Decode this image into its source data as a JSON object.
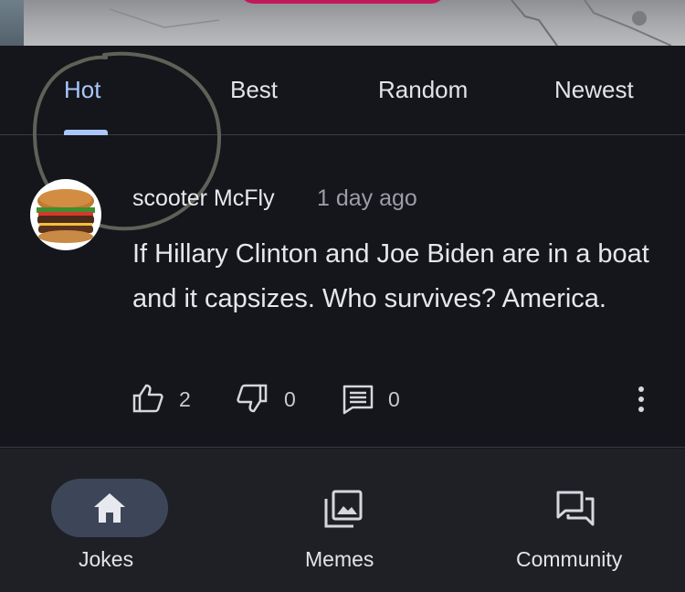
{
  "tabs": [
    {
      "label": "Hot",
      "active": true
    },
    {
      "label": "Best",
      "active": false
    },
    {
      "label": "Random",
      "active": false
    },
    {
      "label": "Newest",
      "active": false
    }
  ],
  "post": {
    "author": "scooter McFly",
    "time": "1 day ago",
    "body": "If Hillary Clinton and Joe Biden are in a boat and it capsizes. Who survives? America.",
    "likes": "2",
    "dislikes": "0",
    "comments": "0",
    "avatar_icon": "burger-icon"
  },
  "nav": [
    {
      "label": "Jokes",
      "icon": "home-icon",
      "active": true
    },
    {
      "label": "Memes",
      "icon": "gallery-icon",
      "active": false
    },
    {
      "label": "Community",
      "icon": "forum-icon",
      "active": false
    }
  ],
  "colors": {
    "accent": "#a9c7ff",
    "background": "#15161b",
    "nav_background": "#1e2026",
    "active_pill": "#3d4658"
  }
}
